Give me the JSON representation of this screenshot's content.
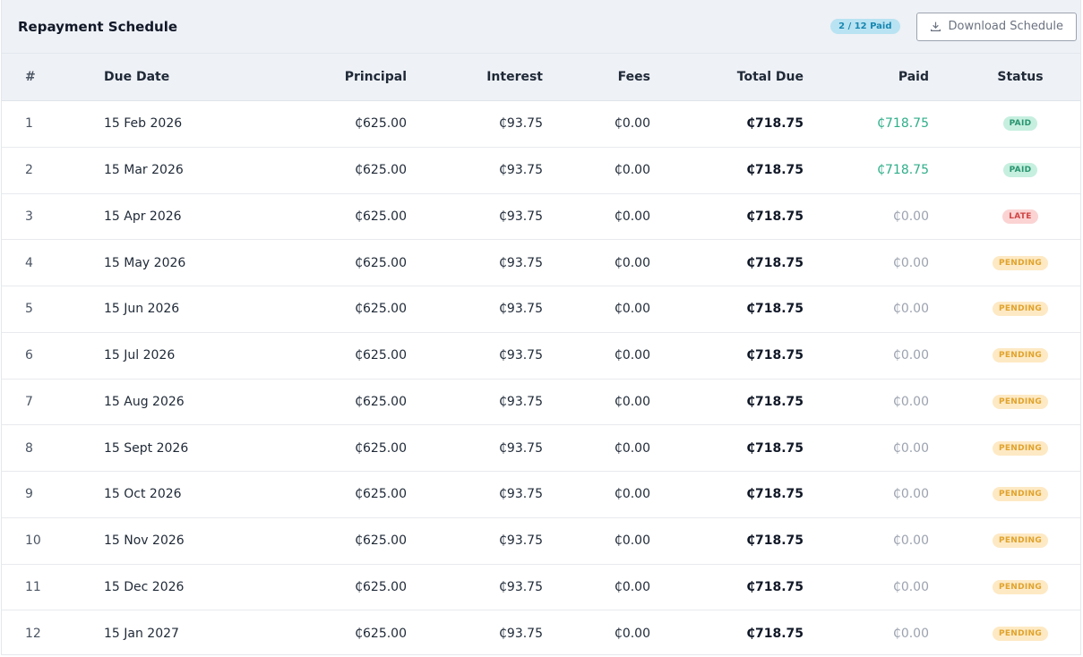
{
  "header": {
    "title": "Repayment Schedule",
    "paid_badge": "2 / 12 Paid",
    "download_label": "Download Schedule"
  },
  "columns": [
    "#",
    "Due Date",
    "Principal",
    "Interest",
    "Fees",
    "Total Due",
    "Paid",
    "Status"
  ],
  "colors": {
    "paid_green": "#2fae88",
    "late_red": "#d04545",
    "pending_amber": "#e0a32d"
  },
  "rows": [
    {
      "num": "1",
      "date": "15 Feb 2026",
      "principal": "₵625.00",
      "interest": "₵93.75",
      "fees": "₵0.00",
      "total": "₵718.75",
      "paid": "₵718.75",
      "status": "PAID"
    },
    {
      "num": "2",
      "date": "15 Mar 2026",
      "principal": "₵625.00",
      "interest": "₵93.75",
      "fees": "₵0.00",
      "total": "₵718.75",
      "paid": "₵718.75",
      "status": "PAID"
    },
    {
      "num": "3",
      "date": "15 Apr 2026",
      "principal": "₵625.00",
      "interest": "₵93.75",
      "fees": "₵0.00",
      "total": "₵718.75",
      "paid": "₵0.00",
      "status": "LATE"
    },
    {
      "num": "4",
      "date": "15 May 2026",
      "principal": "₵625.00",
      "interest": "₵93.75",
      "fees": "₵0.00",
      "total": "₵718.75",
      "paid": "₵0.00",
      "status": "PENDING"
    },
    {
      "num": "5",
      "date": "15 Jun 2026",
      "principal": "₵625.00",
      "interest": "₵93.75",
      "fees": "₵0.00",
      "total": "₵718.75",
      "paid": "₵0.00",
      "status": "PENDING"
    },
    {
      "num": "6",
      "date": "15 Jul 2026",
      "principal": "₵625.00",
      "interest": "₵93.75",
      "fees": "₵0.00",
      "total": "₵718.75",
      "paid": "₵0.00",
      "status": "PENDING"
    },
    {
      "num": "7",
      "date": "15 Aug 2026",
      "principal": "₵625.00",
      "interest": "₵93.75",
      "fees": "₵0.00",
      "total": "₵718.75",
      "paid": "₵0.00",
      "status": "PENDING"
    },
    {
      "num": "8",
      "date": "15 Sept 2026",
      "principal": "₵625.00",
      "interest": "₵93.75",
      "fees": "₵0.00",
      "total": "₵718.75",
      "paid": "₵0.00",
      "status": "PENDING"
    },
    {
      "num": "9",
      "date": "15 Oct 2026",
      "principal": "₵625.00",
      "interest": "₵93.75",
      "fees": "₵0.00",
      "total": "₵718.75",
      "paid": "₵0.00",
      "status": "PENDING"
    },
    {
      "num": "10",
      "date": "15 Nov 2026",
      "principal": "₵625.00",
      "interest": "₵93.75",
      "fees": "₵0.00",
      "total": "₵718.75",
      "paid": "₵0.00",
      "status": "PENDING"
    },
    {
      "num": "11",
      "date": "15 Dec 2026",
      "principal": "₵625.00",
      "interest": "₵93.75",
      "fees": "₵0.00",
      "total": "₵718.75",
      "paid": "₵0.00",
      "status": "PENDING"
    },
    {
      "num": "12",
      "date": "15 Jan 2027",
      "principal": "₵625.00",
      "interest": "₵93.75",
      "fees": "₵0.00",
      "total": "₵718.75",
      "paid": "₵0.00",
      "status": "PENDING"
    }
  ]
}
